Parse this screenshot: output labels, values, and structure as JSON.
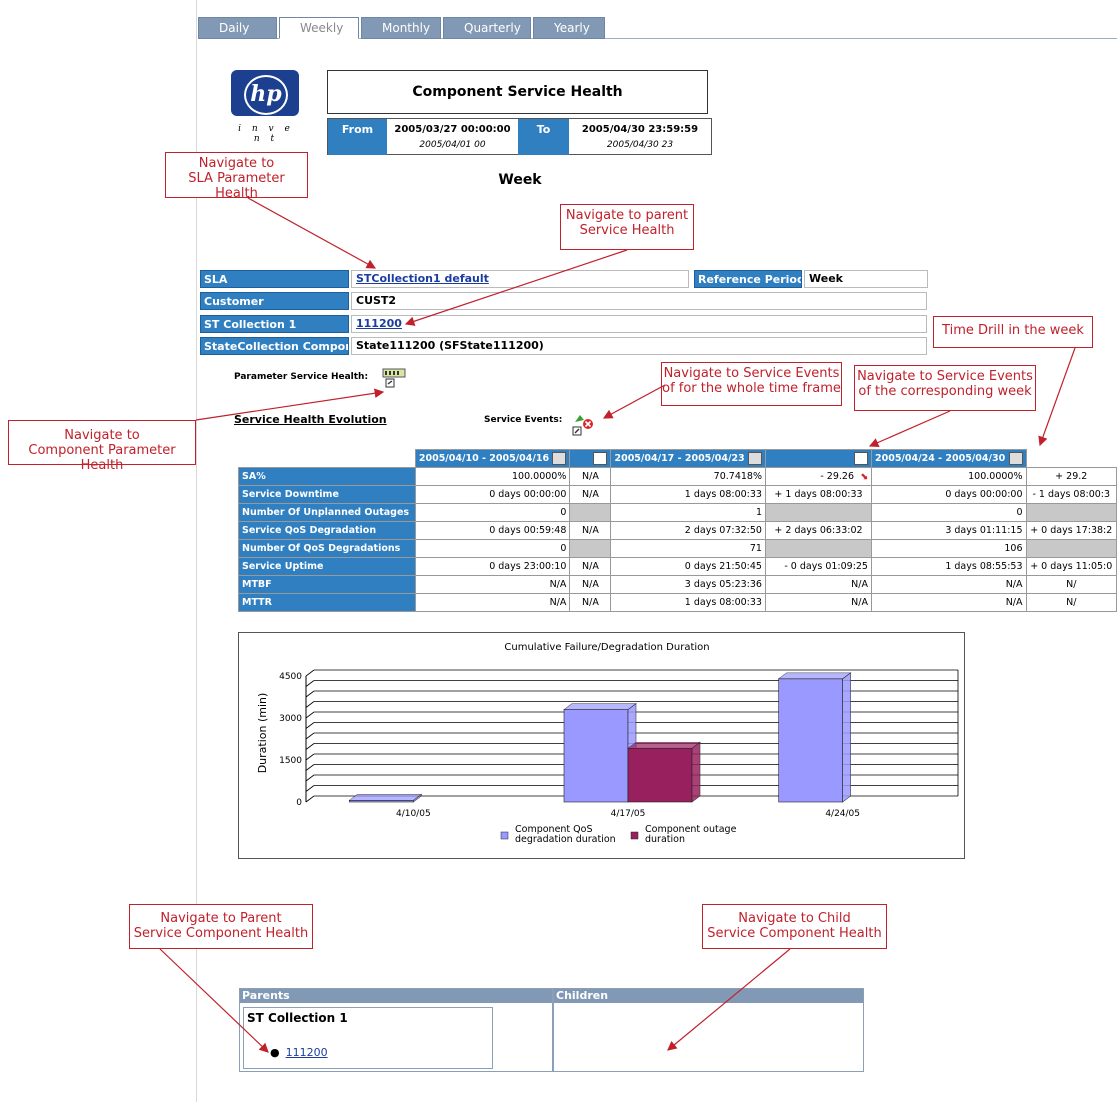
{
  "tabs": [
    {
      "label": "Daily",
      "active": false
    },
    {
      "label": "Weekly",
      "active": true
    },
    {
      "label": "Monthly",
      "active": false
    },
    {
      "label": "Quarterly",
      "active": false
    },
    {
      "label": "Yearly",
      "active": false
    }
  ],
  "logo": {
    "mark": "hp",
    "tagline": "i n v e n t"
  },
  "report": {
    "title": "Component Service Health",
    "from_label": "From",
    "from_value": "2005/03/27 00:00:00",
    "from_sub": "2005/04/01 00",
    "to_label": "To",
    "to_value": "2005/04/30 23:59:59",
    "to_sub": "2005/04/30 23",
    "period": "Week"
  },
  "info": {
    "sla_label": "SLA",
    "sla_value": "STCollection1 default",
    "ref_label": "Reference Period",
    "ref_value": "Week",
    "customer_label": "Customer",
    "customer_value": "CUST2",
    "stc_label": "ST Collection 1",
    "stc_value": "111200",
    "statecoll_label": "StateCollection Componer",
    "statecoll_value": "State111200 (SFState111200)"
  },
  "param_health_label": "Parameter Service Health:",
  "evolution_title": "Service Health Evolution",
  "service_events_label": "Service Events:",
  "table": {
    "headers": [
      "2005/04/10 - 2005/04/16",
      "2005/04/17 - 2005/04/23",
      "2005/04/24 - 2005/04/30"
    ],
    "rows": [
      {
        "label": "SA%",
        "c": [
          "100.0000%",
          "N/A",
          "70.7418%",
          "- 29.26",
          "100.0000%",
          "+ 29.2"
        ],
        "arrow": true
      },
      {
        "label": "Service Downtime",
        "c": [
          "0 days 00:00:00",
          "N/A",
          "1 days 08:00:33",
          "+ 1 days 08:00:33",
          "0 days 00:00:00",
          "- 1 days 08:00:3"
        ]
      },
      {
        "label": "Number Of Unplanned Outages",
        "c": [
          "0",
          "",
          "1",
          "",
          "0",
          ""
        ],
        "gray": true
      },
      {
        "label": "Service QoS Degradation",
        "c": [
          "0 days 00:59:48",
          "N/A",
          "2 days 07:32:50",
          "+ 2 days 06:33:02",
          "3 days 01:11:15",
          "+ 0 days 17:38:2"
        ]
      },
      {
        "label": "Number Of QoS Degradations",
        "c": [
          "0",
          "",
          "71",
          "",
          "106",
          ""
        ],
        "gray": true
      },
      {
        "label": "Service Uptime",
        "c": [
          "0 days 23:00:10",
          "N/A",
          "0 days 21:50:45",
          "- 0 days 01:09:25",
          "1 days 08:55:53",
          "+ 0 days 11:05:0"
        ]
      },
      {
        "label": "MTBF",
        "c": [
          "N/A",
          "N/A",
          "3 days 05:23:36",
          "N/A",
          "N/A",
          "N/"
        ]
      },
      {
        "label": "MTTR",
        "c": [
          "N/A",
          "N/A",
          "1 days 08:00:33",
          "N/A",
          "N/A",
          "N/"
        ]
      }
    ]
  },
  "chart_data": {
    "type": "bar",
    "title": "Cumulative Failure/Degradation Duration",
    "ylabel": "Duration (min)",
    "xlabel": "",
    "categories": [
      "4/10/05",
      "4/17/05",
      "4/24/05"
    ],
    "ylim": [
      0,
      4500
    ],
    "yticks": [
      "0",
      "1500",
      "3000",
      "4500"
    ],
    "series": [
      {
        "name": "Component QoS degradation duration",
        "values": [
          60,
          3300,
          4400
        ],
        "color": "#9999ff"
      },
      {
        "name": "Component outage duration",
        "values": [
          0,
          1920,
          0
        ],
        "color": "#99205f"
      }
    ],
    "legend_position": "bottom"
  },
  "parents_panel": {
    "header": "Parents",
    "group": "ST Collection 1",
    "link": "111200"
  },
  "children_panel": {
    "header": "Children"
  },
  "callouts": {
    "sla_param": [
      "Navigate to",
      "SLA Parameter Health"
    ],
    "parent_sh": [
      "Navigate to parent",
      "Service Health"
    ],
    "time_drill": [
      "Time Drill in the week"
    ],
    "events_whole": [
      "Navigate to Service Events",
      "of for the whole time frame"
    ],
    "events_week": [
      "Navigate to Service Events",
      "of the corresponding week"
    ],
    "comp_param": [
      "Navigate to",
      "Component Parameter Health"
    ],
    "parent_comp": [
      "Navigate to Parent",
      "Service Component Health"
    ],
    "child_comp": [
      "Navigate to Child",
      "Service Component Health"
    ]
  },
  "colors": {
    "accent_blue": "#2f7fc1",
    "tab_blue": "#8299b5",
    "callout_red": "#c0212b",
    "hp_blue": "#1c3f8f"
  }
}
